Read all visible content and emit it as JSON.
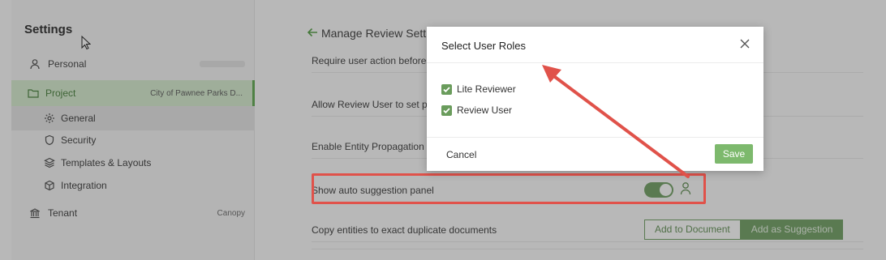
{
  "sidebar": {
    "title": "Settings",
    "items": [
      {
        "label": "Personal",
        "meta": "",
        "icon": "user-icon"
      },
      {
        "label": "Project",
        "meta": "City of Pawnee Parks D...",
        "icon": "folder-icon"
      },
      {
        "label": "General",
        "icon": "gear-icon"
      },
      {
        "label": "Security",
        "icon": "shield-icon"
      },
      {
        "label": "Templates & Layouts",
        "icon": "layers-icon"
      },
      {
        "label": "Integration",
        "icon": "cube-icon"
      },
      {
        "label": "Tenant",
        "meta": "Canopy",
        "icon": "bank-icon"
      }
    ]
  },
  "main": {
    "title": "Manage Review Settings",
    "rows": [
      {
        "label": "Require user action before"
      },
      {
        "label": "Allow Review User to set p"
      },
      {
        "label": "Enable Entity Propagation"
      },
      {
        "label": "Show auto suggestion panel"
      },
      {
        "label": "Copy entities to exact duplicate documents"
      }
    ],
    "toggle_on": true,
    "buttons": {
      "add_to_document": "Add to Document",
      "add_as_suggestion": "Add as Suggestion"
    }
  },
  "modal": {
    "title": "Select User Roles",
    "options": [
      {
        "label": "Lite Reviewer",
        "checked": true
      },
      {
        "label": "Review User",
        "checked": true
      }
    ],
    "cancel": "Cancel",
    "save": "Save"
  },
  "colors": {
    "accent": "#6a9c5c",
    "annotation": "#e0524a",
    "project_bg": "#d5eccd"
  }
}
